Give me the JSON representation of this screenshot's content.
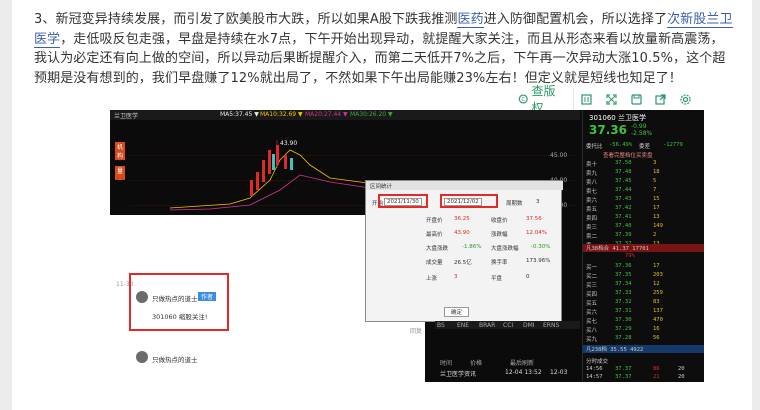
{
  "article": {
    "para_part1": "3、新冠变异持续发展，而引发了欧美股市大跌，所以如果A股下跌我推测",
    "link1": "医药",
    "para_part2": "进入防御配置机会，所以选择了",
    "link2": "次新股兰卫医学",
    "para_part3": "，走低吸反包走强，早盘是持续在水7点，下午开始出现异动，就提醒大家关注，而且从形态来看以放量新高震荡，我认为必定还有向上做的空间，所以异动后果断提醒介入，而第二天低开7%之后，下午再一次异动大涨10.5%，这个超预期是没有想到的，我们早盘赚了12%就出局了，不然如果下午出局能赚23%左右！但定义就是短线也知足了！"
  },
  "toolbar": {
    "view_label": "查版权",
    "icons": [
      "copyright-icon",
      "expand-icon",
      "save-icon",
      "share-icon",
      "settings-icon"
    ]
  },
  "screenshot": {
    "chart_tab_title": "兰卫医学",
    "ma_label": "MA5:37.45 ▼",
    "ma10_label": "MA10:32.69 ▼",
    "ma20_label": "MA20:27.44 ▼",
    "ma30_label": "MA30:26.20 ▼",
    "peak_price": "43.90",
    "price_ticks": [
      "45.00",
      "40.00",
      "35.00",
      "30.00",
      "25.00",
      "20.00"
    ],
    "side_btn1": "机构",
    "side_btn2": "量",
    "bottom_tabs": [
      "BS",
      "ENE",
      "BRAR",
      "CCI",
      "DMI",
      "ERNS"
    ],
    "bottom_row": [
      "时间",
      "价格",
      "最后刷新",
      "成交"
    ],
    "bottom_item": [
      "兰卫医学资讯",
      "12-04 13:52",
      "12-03"
    ]
  },
  "quote": {
    "code_name": "301060 兰卫医学",
    "price": "37.36",
    "change": "-0.99",
    "change_pct": "-2.58%",
    "header1": "委托比",
    "header1_val": "-56.49%",
    "header2": "委差",
    "header2_val": "-12779",
    "header3": "查看完整档位买卖盘",
    "sell_rows": [
      [
        "卖十",
        "37.50",
        "3"
      ],
      [
        "卖九",
        "37.48",
        "18"
      ],
      [
        "卖八",
        "37.45",
        "5"
      ],
      [
        "卖七",
        "37.44",
        "7"
      ],
      [
        "卖六",
        "37.43",
        "15"
      ],
      [
        "卖五",
        "37.42",
        "17"
      ],
      [
        "卖四",
        "37.41",
        "13"
      ],
      [
        "卖三",
        "37.40",
        "149"
      ],
      [
        "卖二",
        "37.39",
        "2"
      ],
      [
        "卖一",
        "37.37",
        "13"
      ]
    ],
    "buy_rows": [
      [
        "买一",
        "37.36",
        "17"
      ],
      [
        "买二",
        "37.35",
        "203"
      ],
      [
        "买三",
        "37.34",
        "12"
      ],
      [
        "买四",
        "37.33",
        "259"
      ],
      [
        "买五",
        "37.32",
        "83"
      ],
      [
        "买六",
        "37.31",
        "137"
      ],
      [
        "买七",
        "37.30",
        "470"
      ],
      [
        "买八",
        "37.29",
        "16"
      ],
      [
        "买九",
        "37.28",
        "56"
      ]
    ],
    "sum_sell": "凡38档合 41.37 17701",
    "sum_buy": "凡238档 35.55 4922",
    "pct": "79%",
    "tick_title": "分时成交",
    "ticks": [
      [
        "14:56",
        "37.37",
        "86",
        "20"
      ],
      [
        "14:57",
        "37.37",
        "21",
        "20"
      ]
    ]
  },
  "chat": {
    "user_name": "只做热点的道士",
    "badge": "作者",
    "message": "301060 缩股关注!",
    "time": "11-30",
    "user_name2": "只做热点的道士",
    "reply_btn": "回复"
  },
  "dialog": {
    "title": "区间统计",
    "start_label": "开始",
    "start_date": "2021/11/30",
    "end_label": "结束",
    "end_date": "2021/12/02",
    "days_label": "周期数",
    "days": "3",
    "open_label": "开盘价",
    "open_val": "36.25",
    "close_label": "收盘价",
    "close_val": "37.56",
    "high_label": "最高价",
    "high_val": "43.90",
    "low_label": "涨跌幅",
    "low_val": "12.04%",
    "amp_label": "大盘涨跌",
    "amp_val": "-1.86%",
    "amp2_label": "大盘涨跌幅",
    "amp2_val": "-0.30%",
    "vol_label": "成交量",
    "vol_val": "26.5亿",
    "turn_label": "换手率",
    "turn_val": "173.96%",
    "up_label": "上涨",
    "up_val": "3",
    "flat_label": "平盘",
    "flat_val": "0",
    "ok_btn": "确定"
  }
}
